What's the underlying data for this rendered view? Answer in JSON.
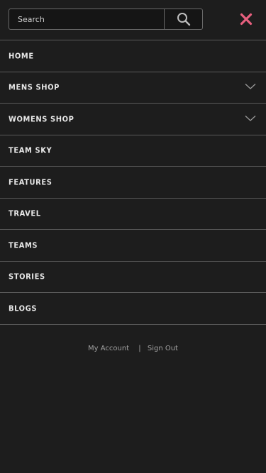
{
  "search": {
    "placeholder": "Search"
  },
  "icons": {
    "search": "search-icon",
    "close": "close-icon",
    "chevron": "chevron-down-icon"
  },
  "colors": {
    "background": "#1d1d1d",
    "close_accent": "#e8607f",
    "divider": "#5b5b5b"
  },
  "nav": {
    "items": [
      {
        "label": "HOME",
        "expandable": false
      },
      {
        "label": "MENS SHOP",
        "expandable": true
      },
      {
        "label": "WOMENS SHOP",
        "expandable": true
      },
      {
        "label": "TEAM SKY",
        "expandable": false
      },
      {
        "label": "FEATURES",
        "expandable": false
      },
      {
        "label": "TRAVEL",
        "expandable": false
      },
      {
        "label": "TEAMS",
        "expandable": false
      },
      {
        "label": "STORIES",
        "expandable": false
      },
      {
        "label": "BLOGS",
        "expandable": false
      }
    ]
  },
  "footer": {
    "my_account": "My Account",
    "separator": "|",
    "sign_out": "Sign Out"
  }
}
